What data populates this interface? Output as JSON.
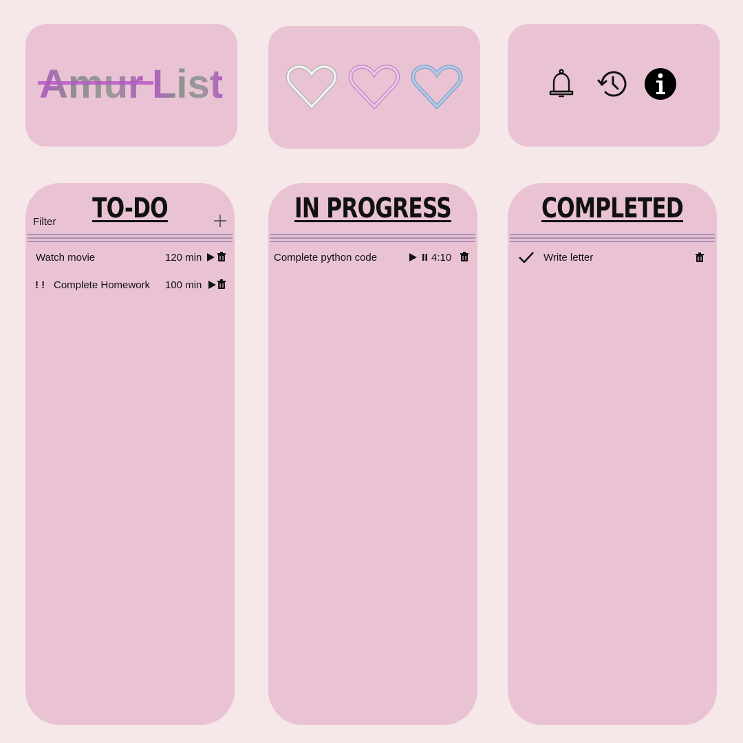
{
  "logo": {
    "text_a": "Amur",
    "text_b": "List"
  },
  "hearts": [
    {
      "name": "white-heart-icon",
      "color": "#f2f2f2",
      "stroke": "#b9b9b9"
    },
    {
      "name": "pink-heart-icon",
      "color": "#e7b6df",
      "stroke": "#c98bc4"
    },
    {
      "name": "blue-heart-icon",
      "color": "#a5bfe0",
      "stroke": "#8aa4c8"
    }
  ],
  "header_icons": [
    "bell-icon",
    "history-icon",
    "info-icon"
  ],
  "columns": {
    "todo": {
      "title": "TO-DO",
      "filter_label": "Filter",
      "items": [
        {
          "priority": "",
          "title": "Watch movie",
          "duration": "120 min"
        },
        {
          "priority": "! !",
          "title": "Complete Homework",
          "duration": "100 min"
        }
      ]
    },
    "progress": {
      "title": "IN PROGRESS",
      "items": [
        {
          "title": "Complete python code",
          "time": "4:10"
        }
      ]
    },
    "completed": {
      "title": "COMPLETED",
      "items": [
        {
          "title": "Write letter"
        }
      ]
    }
  },
  "colors": {
    "background": "#f6e7e9",
    "card": "#e9c3d4",
    "separator": "#a98fb3",
    "logo_purple": "#b45bc4",
    "logo_gray": "#8c8c8c"
  }
}
